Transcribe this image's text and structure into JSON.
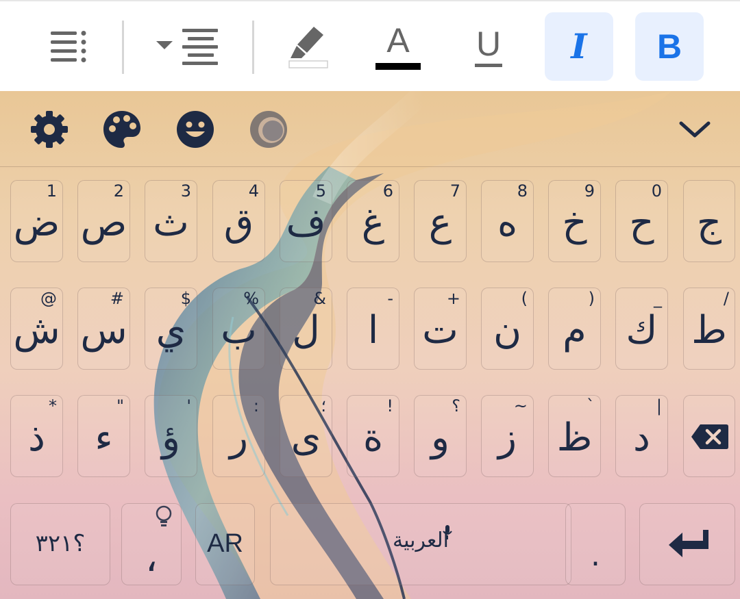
{
  "toolbar": {
    "items": [
      {
        "name": "numbered-list-icon",
        "active": false
      },
      {
        "name": "align-center-icon",
        "active": false
      },
      {
        "name": "highlighter-icon",
        "active": false
      },
      {
        "name": "text-color-icon",
        "label": "A",
        "active": false
      },
      {
        "name": "underline-icon",
        "label": "U",
        "active": false
      },
      {
        "name": "italic-icon",
        "label": "I",
        "active": true
      },
      {
        "name": "bold-icon",
        "label": "B",
        "active": true
      }
    ],
    "text_color": "#000000",
    "highlight_color": "#ffffff",
    "active_color": "#1a73e8"
  },
  "suggestion_strip": {
    "icons": [
      "gear-icon",
      "palette-icon",
      "emoji-icon",
      "theme-icon",
      "chevron-down-icon"
    ]
  },
  "keys": {
    "row1": [
      {
        "main": "ض",
        "hint": "1"
      },
      {
        "main": "ص",
        "hint": "2"
      },
      {
        "main": "ث",
        "hint": "3"
      },
      {
        "main": "ق",
        "hint": "4"
      },
      {
        "main": "ف",
        "hint": "5"
      },
      {
        "main": "غ",
        "hint": "6"
      },
      {
        "main": "ع",
        "hint": "7"
      },
      {
        "main": "ه",
        "hint": "8"
      },
      {
        "main": "خ",
        "hint": "9"
      },
      {
        "main": "ح",
        "hint": "0"
      },
      {
        "main": "ج",
        "hint": ""
      }
    ],
    "row2": [
      {
        "main": "ش",
        "hint": "@"
      },
      {
        "main": "س",
        "hint": "#"
      },
      {
        "main": "ي",
        "hint": "$"
      },
      {
        "main": "ب",
        "hint": "%"
      },
      {
        "main": "ل",
        "hint": "&"
      },
      {
        "main": "ا",
        "hint": "-"
      },
      {
        "main": "ت",
        "hint": "+"
      },
      {
        "main": "ن",
        "hint": "("
      },
      {
        "main": "م",
        "hint": ")"
      },
      {
        "main": "ك",
        "hint": "_"
      },
      {
        "main": "ط",
        "hint": "/"
      }
    ],
    "row3": [
      {
        "main": "ذ",
        "hint": "*"
      },
      {
        "main": "ء",
        "hint": "\""
      },
      {
        "main": "ؤ",
        "hint": "'"
      },
      {
        "main": "ر",
        "hint": ":"
      },
      {
        "main": "ى",
        "hint": "؛"
      },
      {
        "main": "ة",
        "hint": "!"
      },
      {
        "main": "و",
        "hint": "؟"
      },
      {
        "main": "ز",
        "hint": "~"
      },
      {
        "main": "ظ",
        "hint": "`"
      },
      {
        "main": "د",
        "hint": "|"
      }
    ],
    "bottom": {
      "symbols": "؟٣٢١",
      "comma": "،",
      "language": "AR",
      "space": "العربية",
      "period": "."
    }
  },
  "colors": {
    "key_text": "#1e2a44",
    "toolbar_icon": "#666666",
    "active_bg": "#e8f0fe"
  }
}
